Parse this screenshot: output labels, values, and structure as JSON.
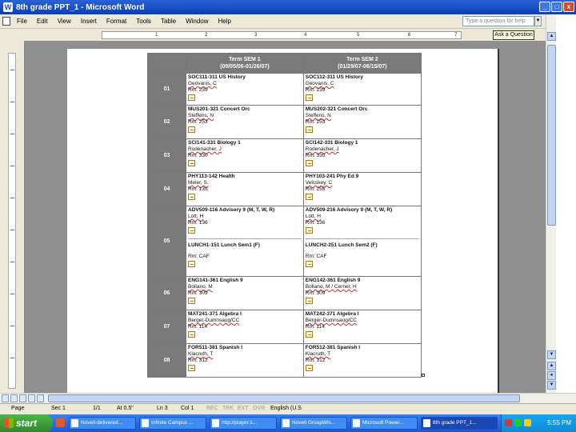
{
  "window": {
    "title": "8th grade PPT_1 - Microsoft Word",
    "minimize": "_",
    "restore": "□",
    "close": "x"
  },
  "menu": {
    "items": [
      "File",
      "Edit",
      "View",
      "Insert",
      "Format",
      "Tools",
      "Table",
      "Window",
      "Help"
    ],
    "help_placeholder": "Type a question for help",
    "close_doc": "x"
  },
  "ruler": {
    "ticks": [
      "1",
      "2",
      "3",
      "4",
      "5",
      "6",
      "7"
    ],
    "tooltip": "Ask a Question"
  },
  "schedule": {
    "headers": [
      {
        "title": "Term SEM 1",
        "dates": "(09/05/06-01/26/07)"
      },
      {
        "title": "Term SEM 2",
        "dates": "(01/29/07-06/15/07)"
      }
    ],
    "rows": [
      {
        "period": "01",
        "sem1": {
          "course": "SOC111-311 US History",
          "teacher": "Geovanis, C",
          "room": "Rm: 239"
        },
        "sem2": {
          "course": "SOC112-311 US History",
          "teacher": "Geovanis, C",
          "room": "Rm: 239"
        }
      },
      {
        "period": "02",
        "sem1": {
          "course": "MUS201-321 Concert Orc",
          "teacher": "Steffens, N",
          "room": "Rm: 253"
        },
        "sem2": {
          "course": "MUS202-321 Concert Orc",
          "teacher": "Steffens, N",
          "room": "Rm: 253"
        }
      },
      {
        "period": "03",
        "sem1": {
          "course": "SCI141-331 Biology 1",
          "teacher": "Rodenacher, J",
          "room": "Rm: 330"
        },
        "sem2": {
          "course": "SCI142-331 Biology 1",
          "teacher": "Rodenacher, J",
          "room": "Rm: 330"
        }
      },
      {
        "period": "04",
        "sem1": {
          "course": "PHY113-142 Health",
          "teacher": "Meier, S.",
          "room": "Rm: 135"
        },
        "sem2": {
          "course": "PHY103-241 Phy Ed 9",
          "teacher": "Velcskey, C",
          "room": "Rm: 255"
        }
      },
      {
        "period": "05",
        "sem1": {
          "course": "ADV509-116 Advisory 9 (M, T, W, R)",
          "teacher": "Lott, H",
          "room": "Rm: 136",
          "extra_course": "LUNCH1-151 Lunch Sem1 (F)",
          "extra_room": "Rm: CAF"
        },
        "sem2": {
          "course": "ADV509-216 Advisory 9 (M, T, W, R)",
          "teacher": "Lott, H",
          "room": "Rm: 136",
          "extra_course": "LUNCH2-251 Lunch Sem2 (F)",
          "extra_room": "Rm: CAF"
        }
      },
      {
        "period": "06",
        "sem1": {
          "course": "ENG141-361 English 9",
          "teacher": "Bollano, M",
          "room": "Rm: 309"
        },
        "sem2": {
          "course": "ENG142-361 English 9",
          "teacher": "Bollano, M / Cerner, H",
          "room": "Rm: 309"
        }
      },
      {
        "period": "07",
        "sem1": {
          "course": "MAT241-371 Algebra I",
          "teacher": "Berger-Dumnsaug/CC",
          "room": "Rm: 114"
        },
        "sem2": {
          "course": "MAT242-371 Algebra I",
          "teacher": "Berger-Dumnsaug/CC",
          "room": "Rm: 114"
        }
      },
      {
        "period": "08",
        "sem1": {
          "course": "FOR511-381 Spanish I",
          "teacher": "Klacruth, T",
          "room": "Rm: 312"
        },
        "sem2": {
          "course": "FOR512-381 Spanish I",
          "teacher": "Klacruth, T",
          "room": "Rm: 312"
        }
      }
    ]
  },
  "status": {
    "page": "Page",
    "sec": "Sec 1",
    "pages": "1/1",
    "at": "At 0.5\"",
    "ln": "Ln 3",
    "col": "Col 1",
    "rec": "REC",
    "trk": "TRK",
    "ext": "EXT",
    "ovr": "OVR",
    "lang": "English (U.S"
  },
  "taskbar": {
    "start": "start",
    "tasks": [
      "Novell-delivered...",
      "Infinite Campus ...",
      "http://player.s...",
      "Novell GroupWis...",
      "Microsoft Power...",
      "8th grade PPT_1..."
    ],
    "clock": "5:55 PM"
  },
  "colors": {
    "title_bar": "#0a3fb6",
    "header_gray": "#7a7a7a",
    "doc_background": "#8f8f8f"
  }
}
